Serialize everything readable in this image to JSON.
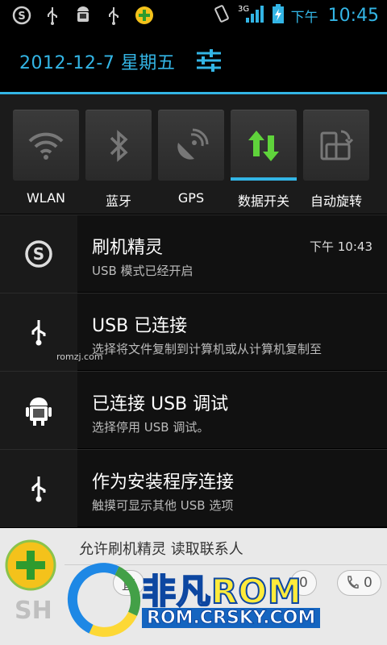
{
  "status_bar": {
    "left_icons": [
      "360-shield-icon",
      "usb-icon",
      "android-debug-icon",
      "usb-icon",
      "360-plus-icon"
    ],
    "network": "3G",
    "ampm": "下午",
    "time": "10:45"
  },
  "header": {
    "date": "2012-12-7 星期五"
  },
  "toggles": [
    {
      "label": "WLAN",
      "icon": "wifi-icon",
      "active": false
    },
    {
      "label": "蓝牙",
      "icon": "bluetooth-icon",
      "active": false
    },
    {
      "label": "GPS",
      "icon": "gps-icon",
      "active": false
    },
    {
      "label": "数据开关",
      "icon": "data-arrows-icon",
      "active": true
    },
    {
      "label": "自动旋转",
      "icon": "rotate-icon",
      "active": false
    }
  ],
  "notifications": [
    {
      "title": "刷机精灵",
      "subtitle": "USB 模式已经开启",
      "time": "下午 10:43",
      "icon": "360-shield-icon"
    },
    {
      "title": "USB 已连接",
      "subtitle": "选择将文件复制到计算机或从计算机复制至",
      "icon": "usb-icon",
      "watermark": "romzj.com"
    },
    {
      "title": "已连接 USB 调试",
      "subtitle": "选择停用 USB 调试。",
      "icon": "android-debug-icon"
    },
    {
      "title": "作为安装程序连接",
      "subtitle": "触摸可显示其他 USB 选项",
      "icon": "usb-icon"
    }
  ],
  "banner": {
    "message": "允许刷机精灵 读取联系人",
    "pill_1": "直",
    "pill_2": "0",
    "pill_3": "0"
  },
  "brand": {
    "title_part1": "非凡",
    "title_part2": "ROM",
    "url": "ROM.CRSKY.COM",
    "corner": "SH"
  },
  "colors": {
    "accent": "#33b5e5",
    "active_green": "#5fd33b"
  }
}
